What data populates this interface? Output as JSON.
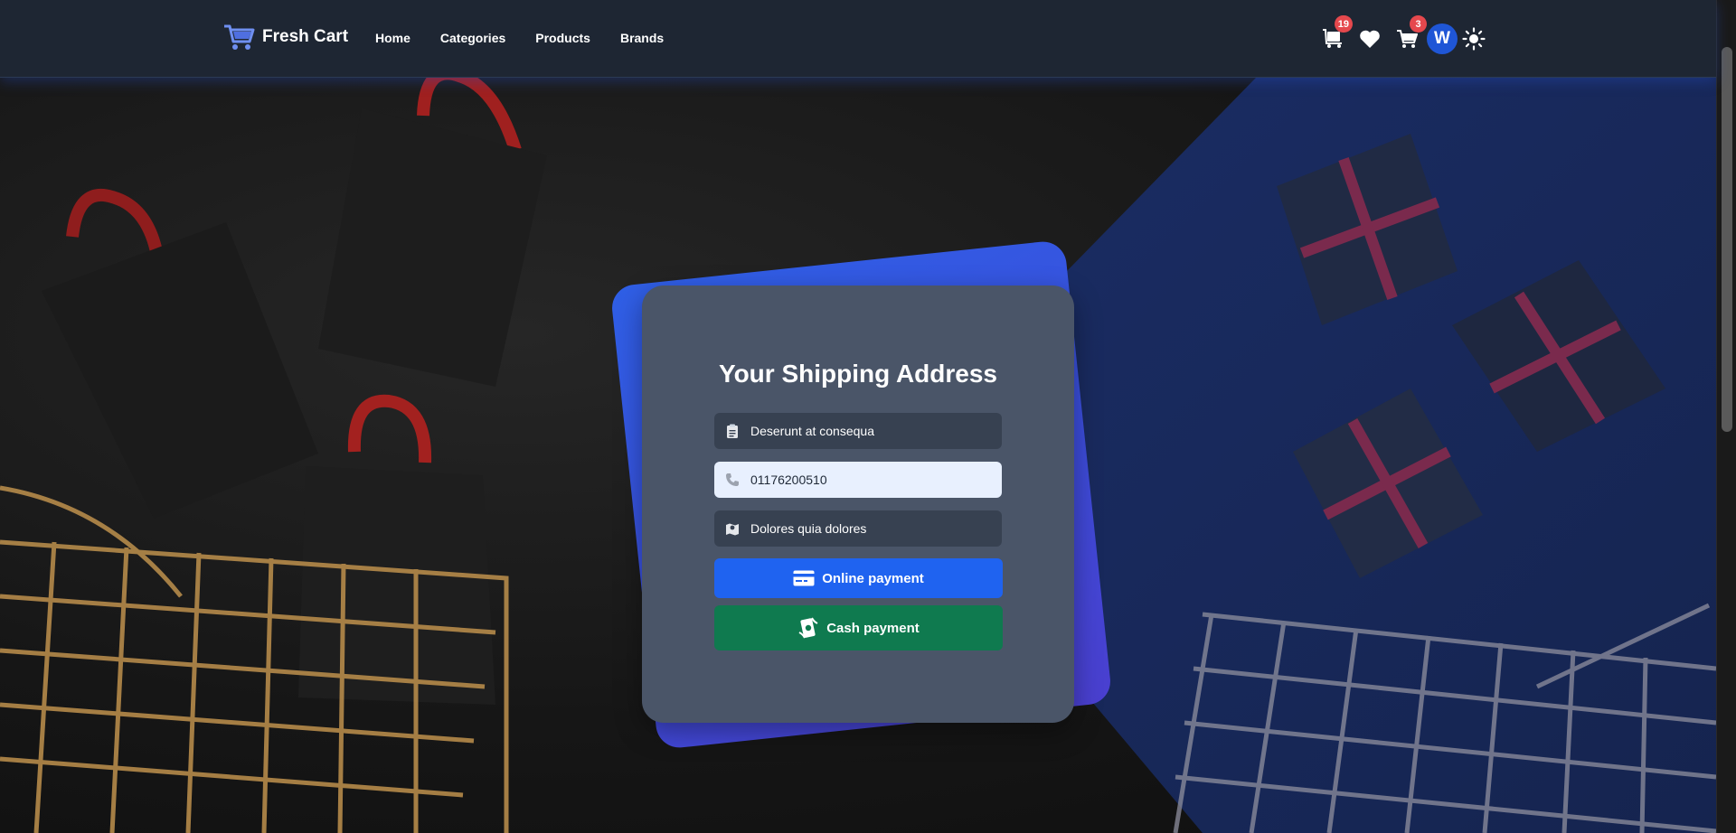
{
  "navbar": {
    "brand": "Fresh Cart",
    "links": [
      "Home",
      "Categories",
      "Products",
      "Brands"
    ],
    "orders_badge": "19",
    "cart_badge": "3",
    "avatar_initial": "W"
  },
  "form": {
    "title": "Your Shipping Address",
    "details_value": "Deserunt at consequa",
    "phone_value": "01176200510",
    "city_value": "Dolores quia dolores",
    "online_button": "Online payment",
    "cash_button": "Cash payment"
  },
  "colors": {
    "primary": "#1f63f0",
    "success": "#0f7a4f",
    "badge": "#e5484d",
    "navbar": "#1e2633",
    "card": "#4a5568"
  },
  "icons": {
    "brand": "cart-icon",
    "orders": "trolley-icon",
    "wishlist": "heart-icon",
    "cart": "shopping-cart-icon",
    "theme": "sun-icon",
    "details": "clipboard-icon",
    "phone": "phone-icon",
    "city": "map-icon",
    "online": "credit-card-icon",
    "cash": "money-icon"
  }
}
